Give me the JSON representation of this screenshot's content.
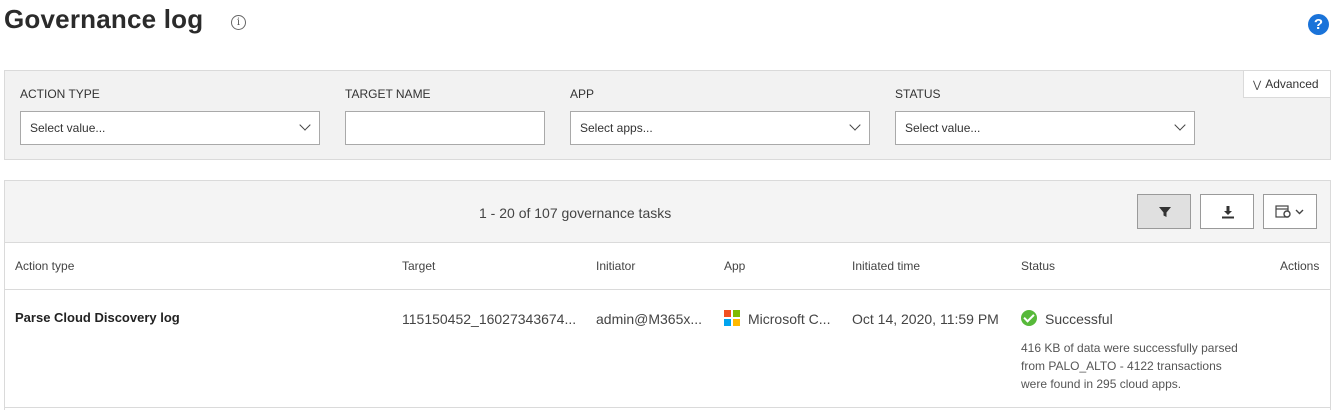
{
  "page": {
    "title": "Governance log",
    "info_icon": "i",
    "help_icon": "?"
  },
  "filters": {
    "advanced_label": "Advanced",
    "action_type": {
      "label": "ACTION TYPE",
      "placeholder": "Select value..."
    },
    "target_name": {
      "label": "TARGET NAME",
      "value": ""
    },
    "app": {
      "label": "APP",
      "placeholder": "Select apps..."
    },
    "status": {
      "label": "STATUS",
      "placeholder": "Select value..."
    }
  },
  "results": {
    "count_text": "1 - 20 of 107 governance tasks",
    "toolbar": {
      "filter_icon": "filter-icon",
      "download_icon": "download-icon",
      "columns_icon": "column-settings-icon"
    },
    "columns": [
      "Action type",
      "Target",
      "Initiator",
      "App",
      "Initiated time",
      "Status",
      "Actions"
    ],
    "rows": [
      {
        "action_type": "Parse Cloud Discovery log",
        "target": "115150452_16027343674...",
        "initiator": "admin@M365x...",
        "app": "Microsoft C...",
        "initiated_time": "Oct 14, 2020, 11:59 PM",
        "status": "Successful",
        "status_detail_lines": [
          "416 KB of data were successfully parsed",
          "from PALO_ALTO - 4122 transactions",
          "were found in 295 cloud apps."
        ]
      }
    ]
  },
  "colors": {
    "help_blue": "#1a73d9",
    "success_green": "#57b93a",
    "panel_gray": "#f2f2f2",
    "ms_red": "#f25022",
    "ms_green": "#7fba00",
    "ms_blue": "#00a4ef",
    "ms_yellow": "#ffb900"
  }
}
